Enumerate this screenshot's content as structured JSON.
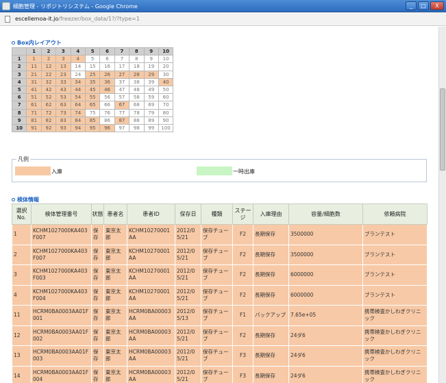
{
  "window": {
    "title": "細胞管理 - リポジトリシステム - Google Chrome",
    "buttons": [
      "_",
      "□",
      "X"
    ]
  },
  "address": {
    "host": "escellemoa-it.jo",
    "path": "/freezer/box_data/1?/?type=1"
  },
  "box_layout": {
    "title": "Box内レイアウト",
    "col_headers": [
      "1",
      "2",
      "3",
      "4",
      "5",
      "6",
      "7",
      "8",
      "9",
      "10"
    ],
    "rows": [
      {
        "label": "1",
        "cells": [
          {
            "v": "1",
            "s": "in"
          },
          {
            "v": "2",
            "s": "in"
          },
          {
            "v": "3",
            "s": "in"
          },
          {
            "v": "4",
            "s": "in"
          },
          {
            "v": "5",
            "s": "out"
          },
          {
            "v": "6",
            "s": "out"
          },
          {
            "v": "7",
            "s": "out"
          },
          {
            "v": "8",
            "s": "out"
          },
          {
            "v": "9",
            "s": "out"
          },
          {
            "v": "10",
            "s": "out"
          }
        ]
      },
      {
        "label": "2",
        "cells": [
          {
            "v": "11",
            "s": "in"
          },
          {
            "v": "12",
            "s": "in"
          },
          {
            "v": "13",
            "s": "in"
          },
          {
            "v": "14",
            "s": "out"
          },
          {
            "v": "15",
            "s": "out"
          },
          {
            "v": "16",
            "s": "out"
          },
          {
            "v": "17",
            "s": "out"
          },
          {
            "v": "18",
            "s": "out"
          },
          {
            "v": "19",
            "s": "out"
          },
          {
            "v": "20",
            "s": "out"
          }
        ]
      },
      {
        "label": "3",
        "cells": [
          {
            "v": "21",
            "s": "in"
          },
          {
            "v": "22",
            "s": "in"
          },
          {
            "v": "23",
            "s": "in"
          },
          {
            "v": "24",
            "s": "out"
          },
          {
            "v": "25",
            "s": "in"
          },
          {
            "v": "26",
            "s": "in"
          },
          {
            "v": "27",
            "s": "in"
          },
          {
            "v": "28",
            "s": "in"
          },
          {
            "v": "29",
            "s": "in"
          },
          {
            "v": "30",
            "s": "out"
          }
        ]
      },
      {
        "label": "4",
        "cells": [
          {
            "v": "31",
            "s": "in"
          },
          {
            "v": "32",
            "s": "in"
          },
          {
            "v": "33",
            "s": "in"
          },
          {
            "v": "34",
            "s": "in"
          },
          {
            "v": "35",
            "s": "in"
          },
          {
            "v": "36",
            "s": "in"
          },
          {
            "v": "37",
            "s": "out"
          },
          {
            "v": "38",
            "s": "out"
          },
          {
            "v": "39",
            "s": "out"
          },
          {
            "v": "40",
            "s": "in"
          }
        ]
      },
      {
        "label": "5",
        "cells": [
          {
            "v": "41",
            "s": "in"
          },
          {
            "v": "42",
            "s": "in"
          },
          {
            "v": "43",
            "s": "in"
          },
          {
            "v": "44",
            "s": "in"
          },
          {
            "v": "45",
            "s": "in"
          },
          {
            "v": "46",
            "s": "in"
          },
          {
            "v": "47",
            "s": "out"
          },
          {
            "v": "48",
            "s": "out"
          },
          {
            "v": "49",
            "s": "out"
          },
          {
            "v": "50",
            "s": "out"
          }
        ]
      },
      {
        "label": "6",
        "cells": [
          {
            "v": "51",
            "s": "in"
          },
          {
            "v": "52",
            "s": "in"
          },
          {
            "v": "53",
            "s": "in"
          },
          {
            "v": "54",
            "s": "in"
          },
          {
            "v": "55",
            "s": "in"
          },
          {
            "v": "56",
            "s": "out"
          },
          {
            "v": "57",
            "s": "out"
          },
          {
            "v": "58",
            "s": "out"
          },
          {
            "v": "59",
            "s": "out"
          },
          {
            "v": "60",
            "s": "out"
          }
        ]
      },
      {
        "label": "7",
        "cells": [
          {
            "v": "61",
            "s": "in"
          },
          {
            "v": "62",
            "s": "in"
          },
          {
            "v": "63",
            "s": "in"
          },
          {
            "v": "64",
            "s": "in"
          },
          {
            "v": "65",
            "s": "in"
          },
          {
            "v": "66",
            "s": "out"
          },
          {
            "v": "67",
            "s": "in"
          },
          {
            "v": "68",
            "s": "out"
          },
          {
            "v": "69",
            "s": "out"
          },
          {
            "v": "70",
            "s": "out"
          }
        ]
      },
      {
        "label": "8",
        "cells": [
          {
            "v": "71",
            "s": "in"
          },
          {
            "v": "72",
            "s": "in"
          },
          {
            "v": "73",
            "s": "in"
          },
          {
            "v": "74",
            "s": "in"
          },
          {
            "v": "75",
            "s": "out"
          },
          {
            "v": "76",
            "s": "out"
          },
          {
            "v": "77",
            "s": "out"
          },
          {
            "v": "78",
            "s": "out"
          },
          {
            "v": "79",
            "s": "out"
          },
          {
            "v": "80",
            "s": "out"
          }
        ]
      },
      {
        "label": "9",
        "cells": [
          {
            "v": "81",
            "s": "in"
          },
          {
            "v": "82",
            "s": "in"
          },
          {
            "v": "83",
            "s": "in"
          },
          {
            "v": "84",
            "s": "in"
          },
          {
            "v": "85",
            "s": "in"
          },
          {
            "v": "86",
            "s": "out"
          },
          {
            "v": "87",
            "s": "in"
          },
          {
            "v": "88",
            "s": "out"
          },
          {
            "v": "89",
            "s": "out"
          },
          {
            "v": "90",
            "s": "out"
          }
        ]
      },
      {
        "label": "10",
        "cells": [
          {
            "v": "91",
            "s": "in"
          },
          {
            "v": "92",
            "s": "in"
          },
          {
            "v": "93",
            "s": "in"
          },
          {
            "v": "94",
            "s": "in"
          },
          {
            "v": "95",
            "s": "in"
          },
          {
            "v": "96",
            "s": "in"
          },
          {
            "v": "97",
            "s": "out"
          },
          {
            "v": "98",
            "s": "out"
          },
          {
            "v": "99",
            "s": "out"
          },
          {
            "v": "100",
            "s": "out"
          }
        ]
      }
    ]
  },
  "legend": {
    "caption": "凡例",
    "in_label": "入庫",
    "tmp_label": "一時出庫",
    "in_color": "#f6c9a4",
    "tmp_color": "#c9f5c4"
  },
  "specimen": {
    "title": "検体情報",
    "headers": [
      "選択No.",
      "検体管理番号",
      "状態",
      "患者名",
      "患者ID",
      "保存日",
      "種類",
      "ステージ",
      "入庫理由",
      "容量/細胞数",
      "依頼病院"
    ],
    "rows": [
      [
        "1",
        "KCHM1027000KA403F007",
        "保存",
        "東京太郎",
        "KCHM10270001AA",
        "2012/05/21",
        "保存チューブ",
        "F2",
        "長期保存",
        "3500000",
        "ブランテスト"
      ],
      [
        "2",
        "KCHM1027000KA403F007",
        "保存",
        "東京太郎",
        "KCHM10270001AA",
        "2012/05/21",
        "保存チューブ",
        "F2",
        "長期保存",
        "3500000",
        "ブランテスト"
      ],
      [
        "3",
        "KCHM1027000KA403F003",
        "保存",
        "東京太郎",
        "KCHM10270001AA",
        "2012/05/21",
        "保存チューブ",
        "F2",
        "長期保存",
        "6000000",
        "ブランテスト"
      ],
      [
        "4",
        "KCHM1027000KA403F004",
        "保存",
        "東京太郎",
        "KCHM10270001AA",
        "2012/05/21",
        "保存チューブ",
        "F2",
        "長期保存",
        "6000000",
        "ブランテスト"
      ],
      [
        "11",
        "HCRM0BA0003AA01F001",
        "保存",
        "東京太郎",
        "HCRM0BA00003AA",
        "2012/05/13",
        "保存チューブ",
        "F1",
        "バックアップ",
        "7.65e+05",
        "携帯検査かしわぎクリニック"
      ],
      [
        "12",
        "HCRM0BA0003AA01F002",
        "保存",
        "東京太郎",
        "HCRM0BA00003AA",
        "2012/05/21",
        "保存チューブ",
        "F2",
        "長期保存",
        "24ダ6",
        "携帯検査かしわぎクリニック"
      ],
      [
        "13",
        "HCRM0BA0003AA01F003",
        "保存",
        "東京太郎",
        "HCRM0BA00003AA",
        "2012/05/21",
        "保存チューブ",
        "F3",
        "長期保存",
        "24ダ6",
        "携帯検査かしわぎクリニック"
      ],
      [
        "14",
        "HCRM0BA0003AA01F004",
        "保存",
        "東京太郎",
        "HCRM0BA00003AA",
        "2012/05/21",
        "保存チューブ",
        "F3",
        "長期保存",
        "24ダ6",
        "携帯検査かしわぎクリニック"
      ]
    ]
  }
}
